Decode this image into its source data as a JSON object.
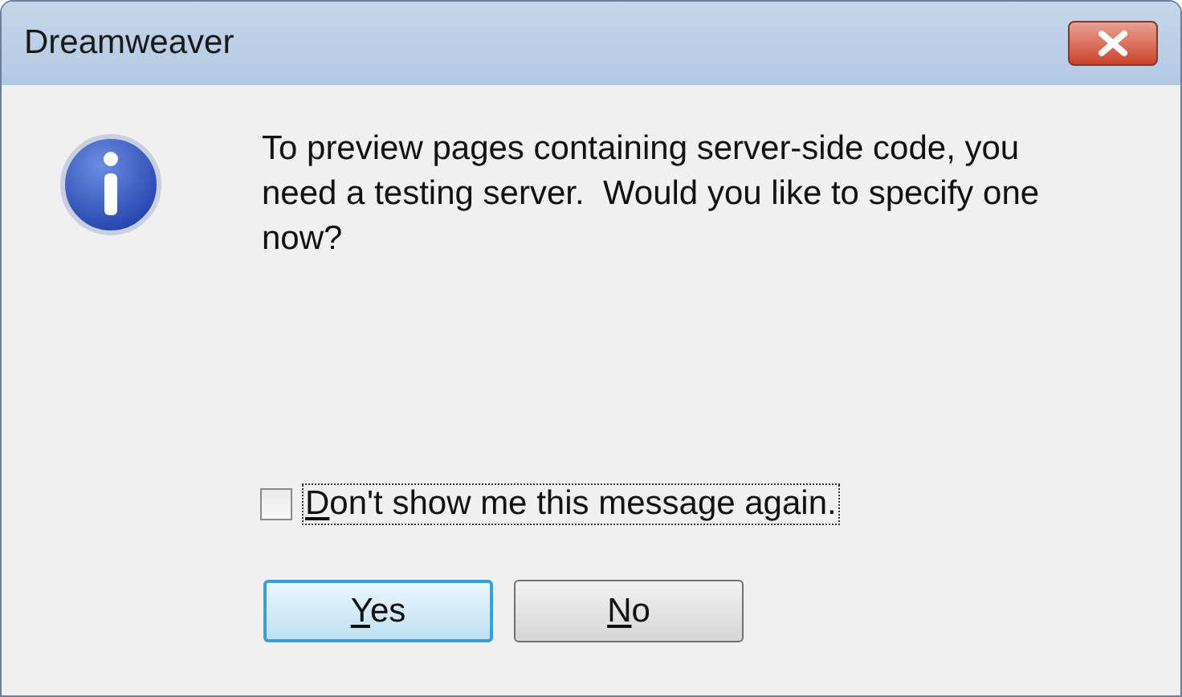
{
  "window": {
    "title": "Dreamweaver"
  },
  "message": "To preview pages containing server-side code, you need a testing server.  Would you like to specify one now?",
  "checkbox": {
    "label": "Don't show me this message again.",
    "checked": false,
    "focused": true,
    "mnemonic_underlined": true
  },
  "buttons": [
    {
      "label": "Yes",
      "default": true,
      "mnemonic_underlined": true
    },
    {
      "label": "No",
      "default": false,
      "mnemonic_underlined": true
    }
  ]
}
